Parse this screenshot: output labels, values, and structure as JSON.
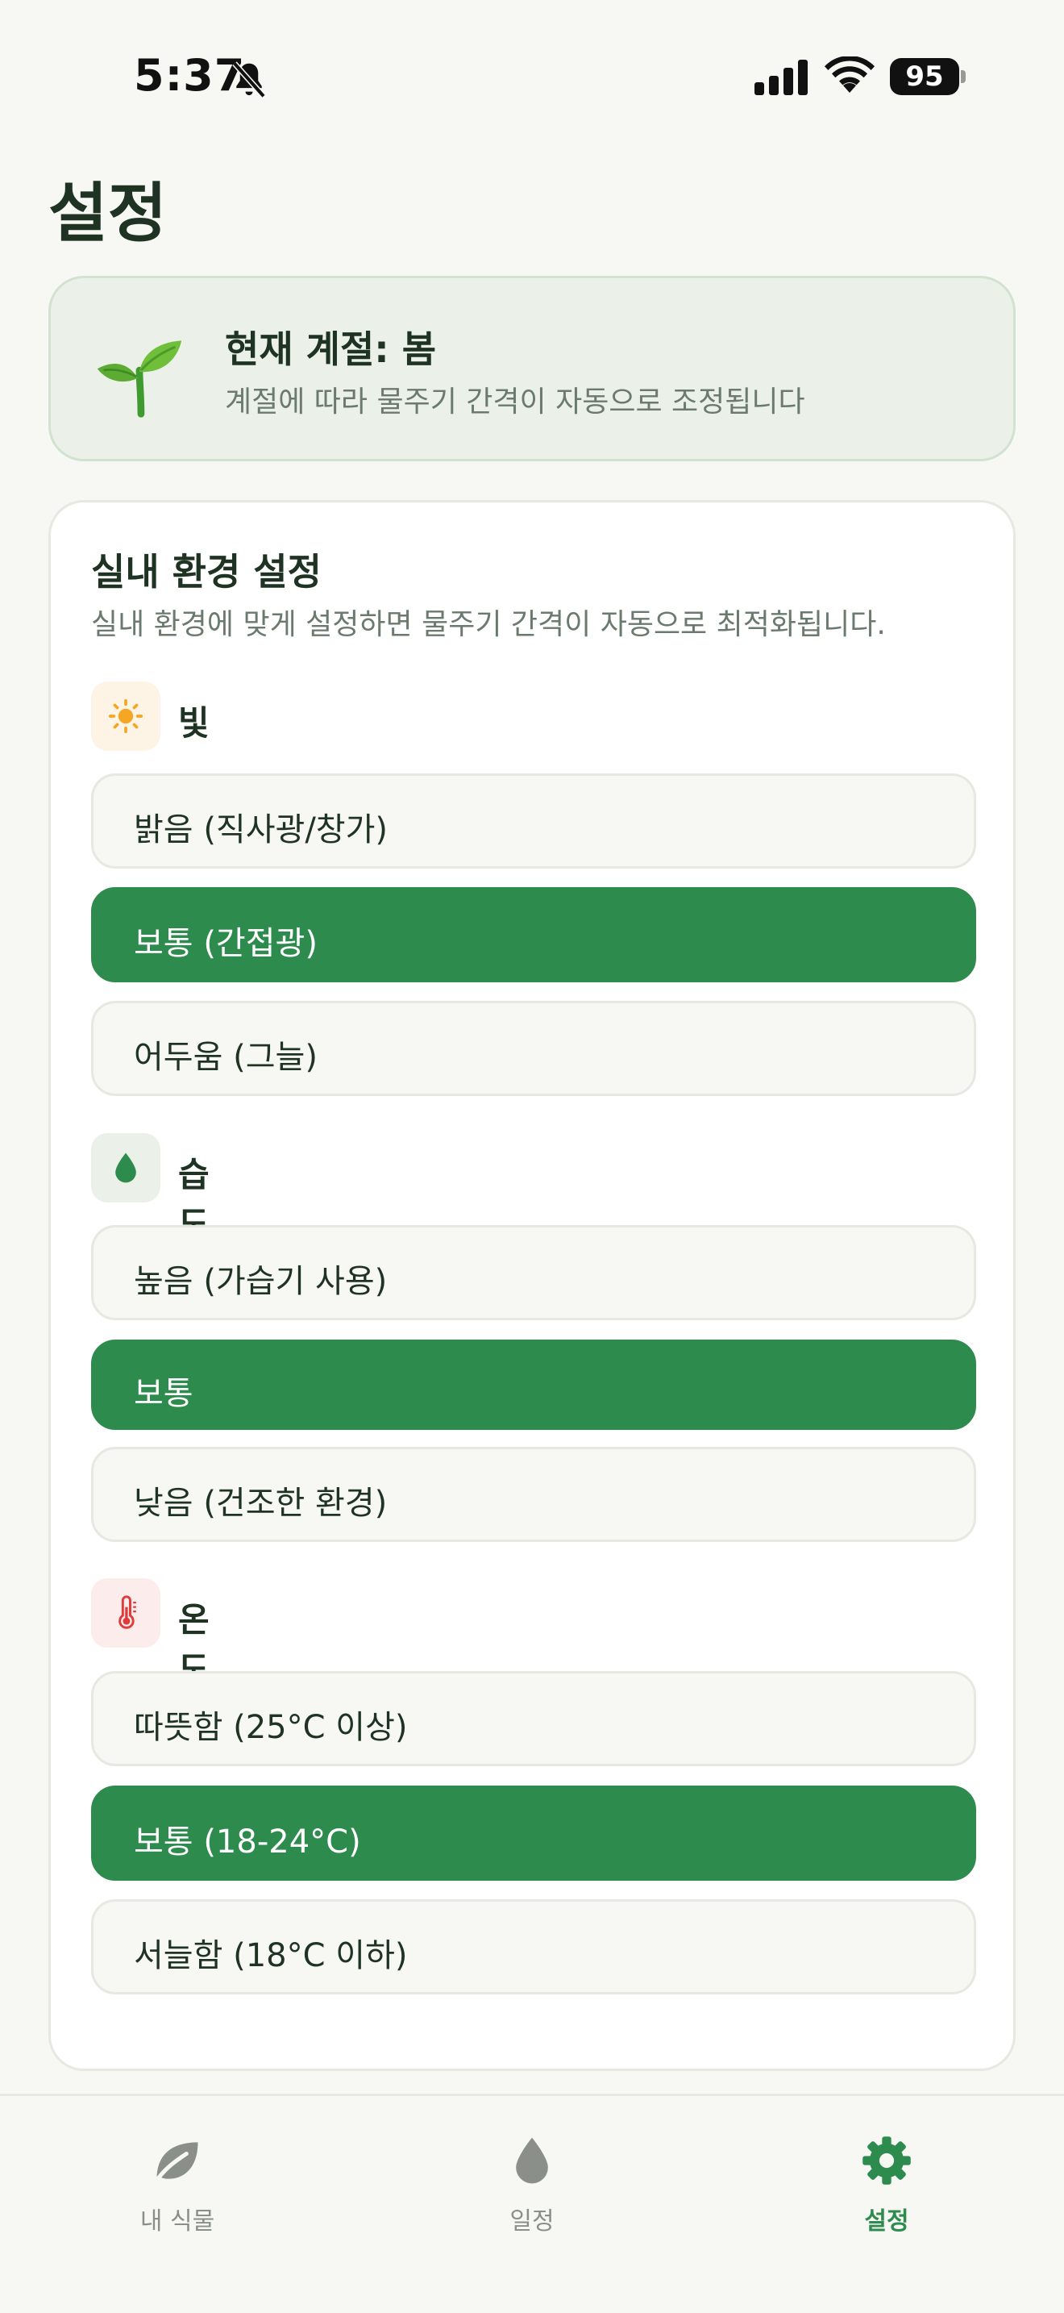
{
  "status_bar": {
    "time": "5:37",
    "battery": "95"
  },
  "page_title": "설정",
  "season": {
    "title": "현재 계절: 봄",
    "description": "계절에 따라 물주기 간격이 자동으로 조정됩니다",
    "icon": "sprout-icon"
  },
  "environment": {
    "title": "실내 환경 설정",
    "description": "실내 환경에 맞게 설정하면 물주기 간격이 자동으로 최적화됩니다.",
    "sections": [
      {
        "label": "빛",
        "icon": "sun-icon",
        "options": [
          "밝음 (직사광/창가)",
          "보통 (간접광)",
          "어두움 (그늘)"
        ],
        "selected": "보통 (간접광)"
      },
      {
        "label": "습도",
        "icon": "droplet-icon",
        "options": [
          "높음 (가습기 사용)",
          "보통",
          "낮음 (건조한 환경)"
        ],
        "selected": "보통"
      },
      {
        "label": "온도",
        "icon": "thermometer-icon",
        "options": [
          "따뜻함 (25°C 이상)",
          "보통 (18-24°C)",
          "서늘함 (18°C 이하)"
        ],
        "selected": "보통 (18-24°C)"
      }
    ]
  },
  "tabs": [
    {
      "label": "내 식물",
      "icon": "leaf-icon"
    },
    {
      "label": "일정",
      "icon": "droplet-icon"
    },
    {
      "label": "설정",
      "icon": "gear-icon"
    }
  ],
  "active_tab": "설정",
  "colors": {
    "accent": "#2e8b4e",
    "background": "#f7f8f3",
    "sun": "#f5a623",
    "thermometer": "#e03b3b"
  }
}
